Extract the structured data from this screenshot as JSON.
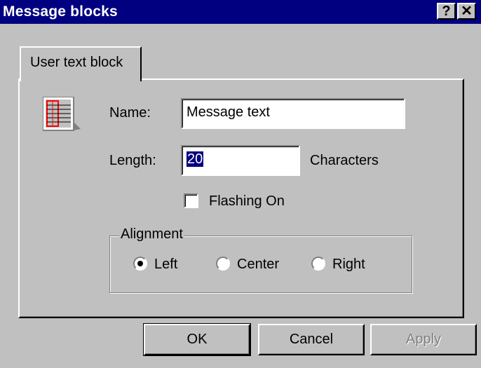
{
  "window": {
    "title": "Message blocks",
    "help_glyph": "?",
    "close_glyph": "✕"
  },
  "tabs": [
    {
      "label": "User text block",
      "selected": true
    }
  ],
  "form": {
    "icon": "text-block-list-icon",
    "name_label": "Name:",
    "name_value": "Message text",
    "length_label": "Length:",
    "length_value": "20",
    "length_unit": "Characters",
    "flashing_label": "Flashing On",
    "flashing_checked": false,
    "alignment": {
      "legend": "Alignment",
      "options": [
        {
          "label": "Left",
          "selected": true
        },
        {
          "label": "Center",
          "selected": false
        },
        {
          "label": "Right",
          "selected": false
        }
      ]
    }
  },
  "buttons": {
    "ok": "OK",
    "cancel": "Cancel",
    "apply": "Apply",
    "apply_enabled": false
  },
  "colors": {
    "titlebar": "#000080",
    "face": "#c0c0c0",
    "icon_accent": "#ff0000"
  }
}
